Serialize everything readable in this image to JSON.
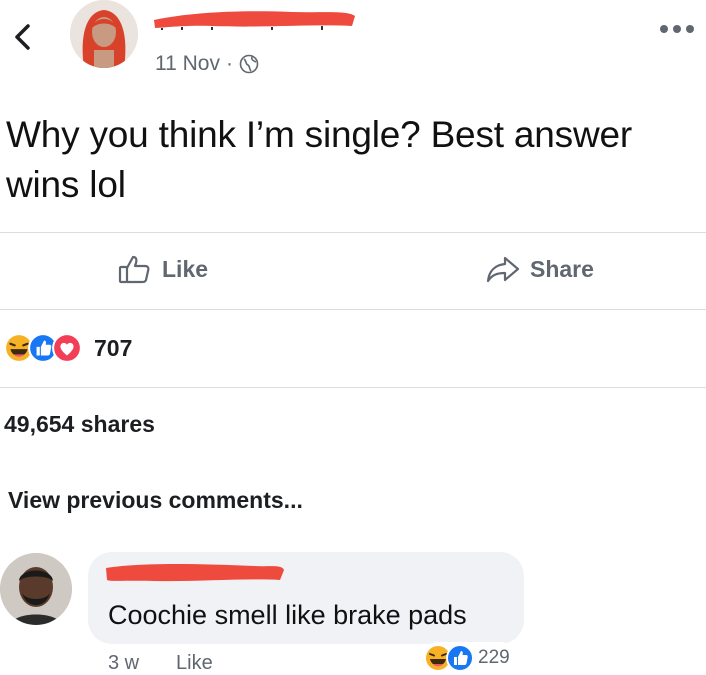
{
  "post": {
    "date": "11 Nov",
    "separator": "·",
    "text": "Why you think I’m single? Best answer wins lol"
  },
  "actions": {
    "like_label": "Like",
    "share_label": "Share"
  },
  "stats": {
    "reaction_count": "707",
    "shares_text": "49,654 shares"
  },
  "comments_section": {
    "view_previous_label": "View previous comments..."
  },
  "comment": {
    "text": "Coochie smell like brake pads",
    "time": "3 w",
    "like_label": "Like",
    "reaction_count": "229"
  },
  "icons": {
    "back": "chevron-left-icon",
    "more": "more-dots-icon",
    "globe": "globe-icon",
    "like": "thumbs-up-outline-icon",
    "share": "share-arrow-icon",
    "haha": "haha-reaction-icon",
    "like_reaction": "like-reaction-icon",
    "love": "love-reaction-icon"
  },
  "colors": {
    "redaction": "#ee4b3e",
    "like_blue": "#1877f2",
    "love_red": "#f33e58",
    "haha_yellow": "#f7b125",
    "secondary_text": "#606770"
  }
}
